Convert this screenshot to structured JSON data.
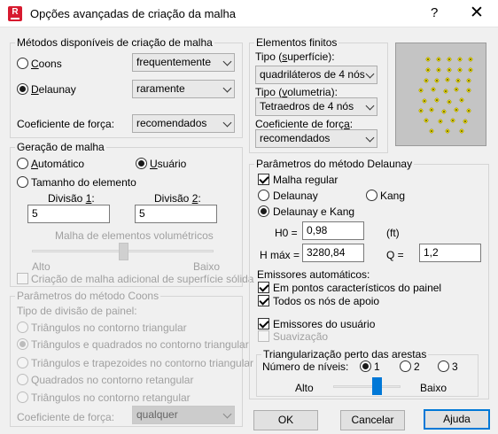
{
  "window": {
    "title": "Opções avançadas de criação da malha",
    "help": "?",
    "close": "✕",
    "app_icon_letter": "R"
  },
  "methods": {
    "legend": "Métodos disponíveis de criação de malha",
    "coons_label": "Coons",
    "coons_selected": false,
    "coons_freq": "frequentemente",
    "delaunay_label": "Delaunay",
    "delaunay_selected": true,
    "delaunay_freq": "raramente",
    "force_label": "Coeficiente de força:",
    "force_value": "recomendados"
  },
  "mesh_gen": {
    "legend": "Geração de malha",
    "auto_label": "Automático",
    "user_label": "Usuário",
    "selected": "user",
    "elem_size_label": "Tamanho do elemento",
    "div1_label": "Divisão 1:",
    "div1_value": "5",
    "div2_label": "Divisão 2:",
    "div2_value": "5",
    "volumetric_label": "Malha de elementos volumétricos",
    "high_label": "Alto",
    "low_label": "Baixo",
    "volumetric_level": 0.5,
    "solid_surface_label": "Criação de malha adicional de superfície sólida",
    "solid_surface_checked": false
  },
  "coons": {
    "legend": "Parâmetros do método Coons",
    "division_type_label": "Tipo de divisão de painel:",
    "options": [
      "Triângulos no contorno triangular",
      "Triângulos e quadrados no contorno triangular",
      "Triângulos e trapezoides no contorno triangular",
      "Quadrados no contorno retangular",
      "Triângulos no contorno retangular"
    ],
    "selected_index": 1,
    "force_label": "Coeficiente de força:",
    "force_value": "qualquer"
  },
  "finite": {
    "legend": "Elementos finitos",
    "surface_type_label": "Tipo (superfície):",
    "surface_type_value": "quadriláteros de 4 nós",
    "volume_type_label": "Tipo (volumetria):",
    "volume_type_value": "Tetraedros de 4 nós",
    "force_label": "Coeficiente de força:",
    "force_value": "recomendados"
  },
  "delaunay": {
    "legend": "Parâmetros do método Delaunay",
    "regular_label": "Malha regular",
    "regular_checked": true,
    "opt_delaunay": "Delaunay",
    "opt_kang": "Kang",
    "opt_both": "Delaunay e Kang",
    "selected": "both",
    "h0_label": "H0 =",
    "h0_value": "0,98",
    "unit": "(ft)",
    "hmax_label": "H máx =",
    "hmax_value": "3280,84",
    "q_label": "Q =",
    "q_value": "1,2",
    "emitters_label": "Emissores automáticos:",
    "emit_points_label": "Em pontos característicos do painel",
    "emit_points_checked": true,
    "emit_nodes_label": "Todos os nós de apoio",
    "emit_nodes_checked": true,
    "user_emitters_label": "Emissores do usuário",
    "user_emitters_checked": true,
    "smoothing_label": "Suavização",
    "smoothing_checked": false
  },
  "edge": {
    "legend": "Triangularização perto das arestas",
    "levels_label": "Número de níveis:",
    "levels": [
      "1",
      "2",
      "3"
    ],
    "selected_level": "1",
    "high_label": "Alto",
    "low_label": "Baixo",
    "slider_level": 0.65
  },
  "buttons": {
    "ok": "OK",
    "cancel": "Cancelar",
    "help": "Ajuda"
  }
}
